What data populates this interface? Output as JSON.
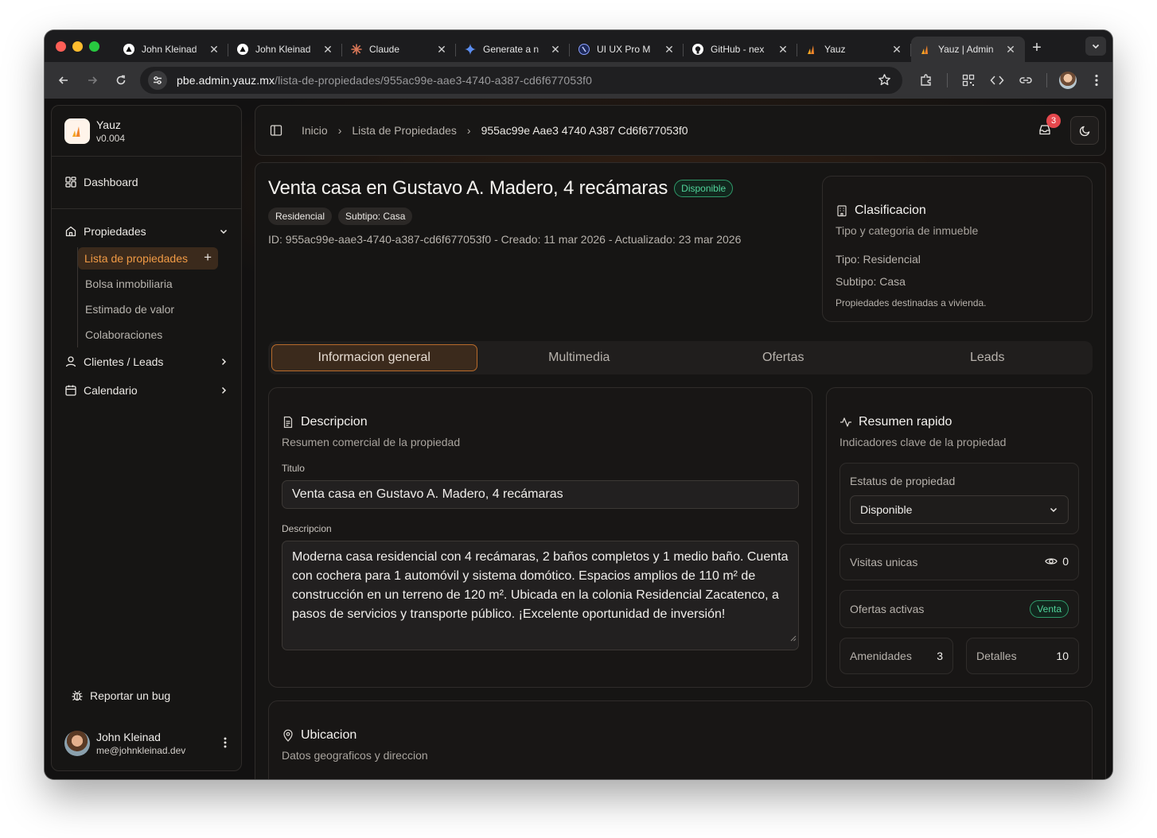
{
  "browser": {
    "tabs": [
      {
        "title": "John Kleinad",
        "icon": "triangle-icon"
      },
      {
        "title": "John Kleinad",
        "icon": "triangle-icon"
      },
      {
        "title": "Claude",
        "icon": "claude-icon"
      },
      {
        "title": "Generate a n",
        "icon": "gemini-icon"
      },
      {
        "title": "UI UX Pro M",
        "icon": "uiux-icon"
      },
      {
        "title": "GitHub - nex",
        "icon": "github-icon"
      },
      {
        "title": "Yauz",
        "icon": "yauz-icon"
      },
      {
        "title": "Yauz | Admin",
        "icon": "yauz-icon"
      }
    ],
    "url_host": "pbe.admin.yauz.mx",
    "url_path": "/lista-de-propiedades/955ac99e-aae3-4740-a387-cd6f677053f0"
  },
  "sidebar": {
    "brand_name": "Yauz",
    "brand_version": "v0.004",
    "dashboard": "Dashboard",
    "propiedades": "Propiedades",
    "sub_items": [
      "Lista de propiedades",
      "Bolsa inmobiliaria",
      "Estimado de valor",
      "Colaboraciones"
    ],
    "clientes": "Clientes / Leads",
    "calendario": "Calendario",
    "report_bug": "Reportar un bug",
    "user_name": "John Kleinad",
    "user_email": "me@johnkleinad.dev"
  },
  "topbar": {
    "breadcrumbs": [
      "Inicio",
      "Lista de Propiedades",
      "955ac99e Aae3 4740 A387 Cd6f677053f0"
    ],
    "notification_count": "3"
  },
  "property": {
    "title": "Venta casa en Gustavo A. Madero, 4 recámaras",
    "status": "Disponible",
    "chips": [
      "Residencial",
      "Subtipo: Casa"
    ],
    "meta": "ID: 955ac99e-aae3-4740-a387-cd6f677053f0 - Creado: 11 mar 2026 - Actualizado: 23 mar 2026"
  },
  "clasificacion": {
    "title": "Clasificacion",
    "subtitle": "Tipo y categoria de inmueble",
    "tipo": "Tipo: Residencial",
    "subtipo": "Subtipo: Casa",
    "nota": "Propiedades destinadas a vivienda."
  },
  "tabs": [
    "Informacion general",
    "Multimedia",
    "Ofertas",
    "Leads"
  ],
  "descripcion": {
    "title": "Descripcion",
    "subtitle": "Resumen comercial de la propiedad",
    "titulo_label": "Titulo",
    "titulo_value": "Venta casa en Gustavo A. Madero, 4 recámaras",
    "descripcion_label": "Descripcion",
    "descripcion_value": "Moderna casa residencial con 4 recámaras, 2 baños completos y 1 medio baño. Cuenta con cochera para 1 automóvil y sistema domótico. Espacios amplios de 110 m² de construcción en un terreno de 120 m². Ubicada en la colonia Residencial Zacatenco, a pasos de servicios y transporte público. ¡Excelente oportunidad de inversión!"
  },
  "resumen": {
    "title": "Resumen rapido",
    "subtitle": "Indicadores clave de la propiedad",
    "estatus_label": "Estatus de propiedad",
    "estatus_value": "Disponible",
    "visitas_label": "Visitas unicas",
    "visitas_value": "0",
    "ofertas_label": "Ofertas activas",
    "ofertas_value": "Venta",
    "amenidades_label": "Amenidades",
    "amenidades_value": "3",
    "detalles_label": "Detalles",
    "detalles_value": "10"
  },
  "ubicacion": {
    "title": "Ubicacion",
    "subtitle": "Datos geograficos y direccion"
  },
  "colors": {
    "accent": "#f09a45",
    "accent_bg": "#3b2a1c",
    "success": "#51d39a",
    "badge": "#e5484d"
  }
}
